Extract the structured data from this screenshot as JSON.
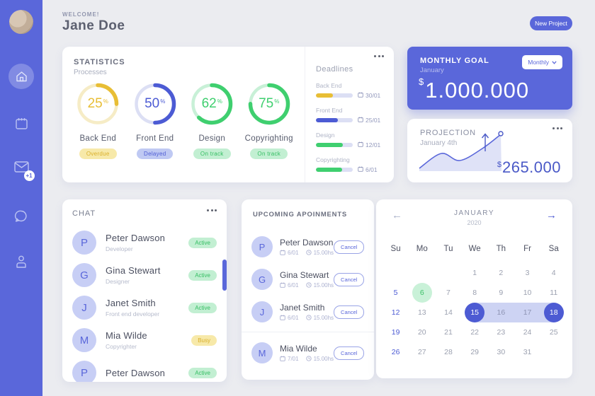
{
  "colors": {
    "sidebar_purple": "#5A67DA",
    "goal_purple": "#5A67DA",
    "projection_amount_blue": "#4A59C7",
    "calendar_selected_purple": "#4D5BD3",
    "calendar_range_band": "#CDD3F3",
    "calendar_green": "#3CC168"
  },
  "themes": {
    "yellow": {
      "main": "#E8BE35",
      "track": "#F6ECC6",
      "badge_bg": "#F7E9A9",
      "badge_text": "#D9AF2B"
    },
    "indigo": {
      "main": "#4C5BD4",
      "track": "#DCDFF4",
      "badge_bg": "#BFC9F3",
      "badge_text": "#4C5BD4"
    },
    "green": {
      "main": "#3FCF6F",
      "track": "#C8F0D7",
      "badge_bg": "#C2EFD2",
      "badge_text": "#35BE63"
    }
  },
  "sidebar": {
    "mail_badge": "+1",
    "icons": [
      "home",
      "calendar",
      "mail",
      "chat",
      "user"
    ],
    "active_icon": "home"
  },
  "header": {
    "welcome": "WELCOME!",
    "user_name": "Jane Doe",
    "new_project_label": "New Project"
  },
  "statistics": {
    "title": "STATISTICS",
    "subtitle": "Processes",
    "processes": [
      {
        "label": "Back End",
        "value": 25,
        "status": "Overdue",
        "theme": "yellow"
      },
      {
        "label": "Front End",
        "value": 50,
        "status": "Delayed",
        "theme": "indigo"
      },
      {
        "label": "Design",
        "value": 62,
        "status": "On track",
        "theme": "green"
      },
      {
        "label": "Copyrighting",
        "value": 75,
        "status": "On track",
        "theme": "green"
      }
    ]
  },
  "deadlines": {
    "title": "Deadlines",
    "items": [
      {
        "label": "Back End",
        "progress": 46,
        "date": "30/01",
        "theme": "yellow"
      },
      {
        "label": "Front End",
        "progress": 60,
        "date": "25/01",
        "theme": "indigo"
      },
      {
        "label": "Design",
        "progress": 74,
        "date": "12/01",
        "theme": "green"
      },
      {
        "label": "Copyrighting",
        "progress": 72,
        "date": "6/01",
        "theme": "green"
      }
    ]
  },
  "monthly_goal": {
    "title": "MONTHLY GOAL",
    "subtitle": "January",
    "currency": "$",
    "amount": "1.000.000",
    "selector_label": "Monthly"
  },
  "projection": {
    "title": "PROJECTION",
    "subtitle": "January 4th",
    "currency": "$",
    "amount": "265.000"
  },
  "chat": {
    "title": "CHAT",
    "members": [
      {
        "initial": "P",
        "name": "Peter Dawson",
        "role": "Developer",
        "status": "Active"
      },
      {
        "initial": "G",
        "name": "Gina Stewart",
        "role": "Designer",
        "status": "Active"
      },
      {
        "initial": "J",
        "name": "Janet Smith",
        "role": "Front end developer",
        "status": "Active"
      },
      {
        "initial": "M",
        "name": "Mia Wilde",
        "role": "Copyrighter",
        "status": "Busy"
      },
      {
        "initial": "P",
        "name": "Peter Dawson",
        "role": "",
        "status": "Active"
      }
    ]
  },
  "appointments": {
    "title": "UPCOMING APOINMENTS",
    "cancel_label": "Cancel",
    "items": [
      {
        "initial": "P",
        "name": "Peter Dawson",
        "date": "6/01",
        "time": "15.00hs",
        "divided": false
      },
      {
        "initial": "G",
        "name": "Gina Stewart",
        "date": "6/01",
        "time": "15.00hs",
        "divided": false
      },
      {
        "initial": "J",
        "name": "Janet Smith",
        "date": "6/01",
        "time": "15.00hs",
        "divided": false
      },
      {
        "initial": "M",
        "name": "Mia Wilde",
        "date": "7/01",
        "time": "15.00hs",
        "divided": true
      }
    ]
  },
  "calendar": {
    "month": "JANUARY",
    "year": "2020",
    "day_names": [
      "Su",
      "Mo",
      "Tu",
      "We",
      "Th",
      "Fr",
      "Sa"
    ],
    "weeks": [
      [
        null,
        null,
        null,
        1,
        2,
        3,
        4
      ],
      [
        5,
        6,
        7,
        8,
        9,
        10,
        11
      ],
      [
        12,
        13,
        14,
        15,
        16,
        17,
        18
      ],
      [
        19,
        20,
        21,
        22,
        23,
        24,
        25
      ],
      [
        26,
        27,
        28,
        29,
        30,
        31,
        null
      ]
    ],
    "sundays": [
      5,
      12,
      19,
      26
    ],
    "green_day": 6,
    "range_start": 15,
    "range_end": 18,
    "in_range": [
      16,
      17
    ]
  },
  "chart_data": [
    {
      "type": "pie",
      "subtype": "donut-progress-set",
      "title": "STATISTICS Processes",
      "categories": [
        "Back End",
        "Front End",
        "Design",
        "Copyrighting"
      ],
      "values": [
        25,
        50,
        62,
        75
      ],
      "statuses": [
        "Overdue",
        "Delayed",
        "On track",
        "On track"
      ],
      "colors": [
        "#E8BE35",
        "#4C5BD4",
        "#3FCF6F",
        "#3FCF6F"
      ]
    },
    {
      "type": "area",
      "title": "PROJECTION January 4th",
      "x": [
        0,
        0.25,
        0.45,
        0.75,
        1
      ],
      "y": [
        0.05,
        0.42,
        0.25,
        0.55,
        0.92
      ],
      "annotation": "$265.000",
      "legend_position": "none"
    }
  ]
}
